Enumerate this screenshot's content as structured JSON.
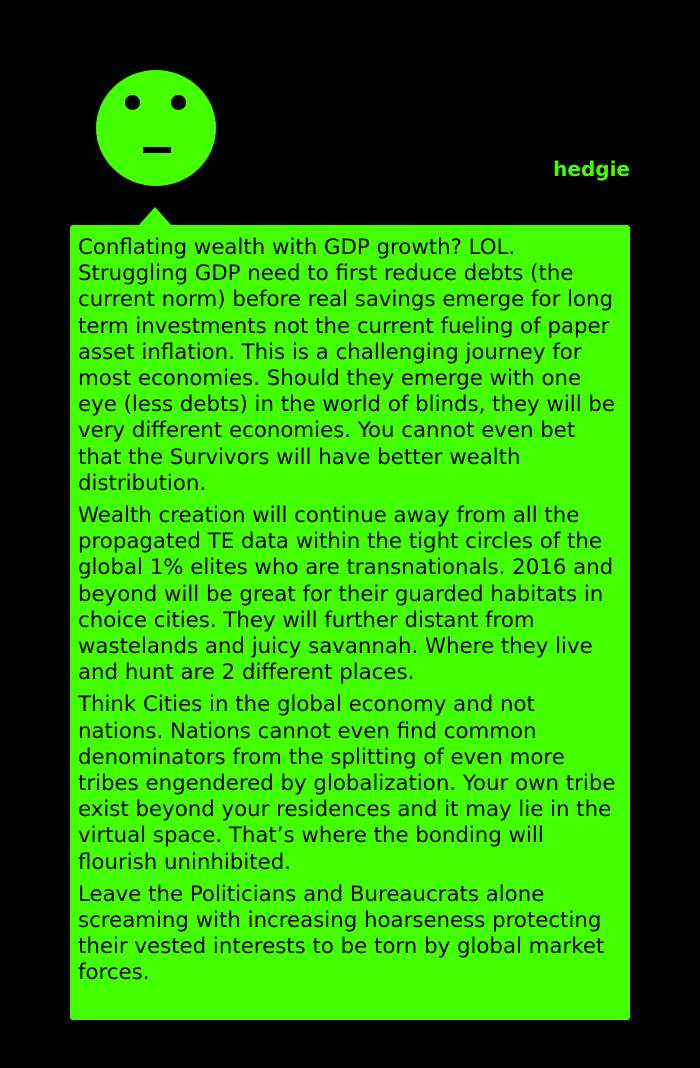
{
  "user": {
    "name": "hedgie"
  },
  "comment": {
    "paragraphs": [
      "Conflating wealth with GDP growth? LOL. Struggling GDP need to first reduce debts (the current norm) before real savings emerge for long term investments not the current fueling of paper asset inflation. This is a challenging journey for most economies. Should they emerge with one eye (less debts) in the world of blinds, they will be very different economies. You cannot even bet that the Survivors will have better wealth distribution.",
      "Wealth creation will continue away from all the propagated TE data within the tight circles of the global 1% elites who are transnationals. 2016 and beyond will be great for their guarded habitats in choice cities. They will further distant from wastelands and juicy savannah. Where they live and hunt are 2 different places.",
      "Think Cities in the global economy and not nations. Nations cannot even find common denominators from the splitting of even more tribes engendered by globalization. Your own tribe exist beyond your residences and it may lie in the virtual space. That’s where the bonding will flourish uninhibited.",
      "Leave the Politicians and Bureaucrats alone screaming with increasing hoarseness protecting their vested interests to be torn by global market forces."
    ]
  },
  "colors": {
    "background": "#000000",
    "accent": "#44ff00",
    "text": "#000000"
  },
  "icons": {
    "avatar": "neutral-face-icon"
  }
}
